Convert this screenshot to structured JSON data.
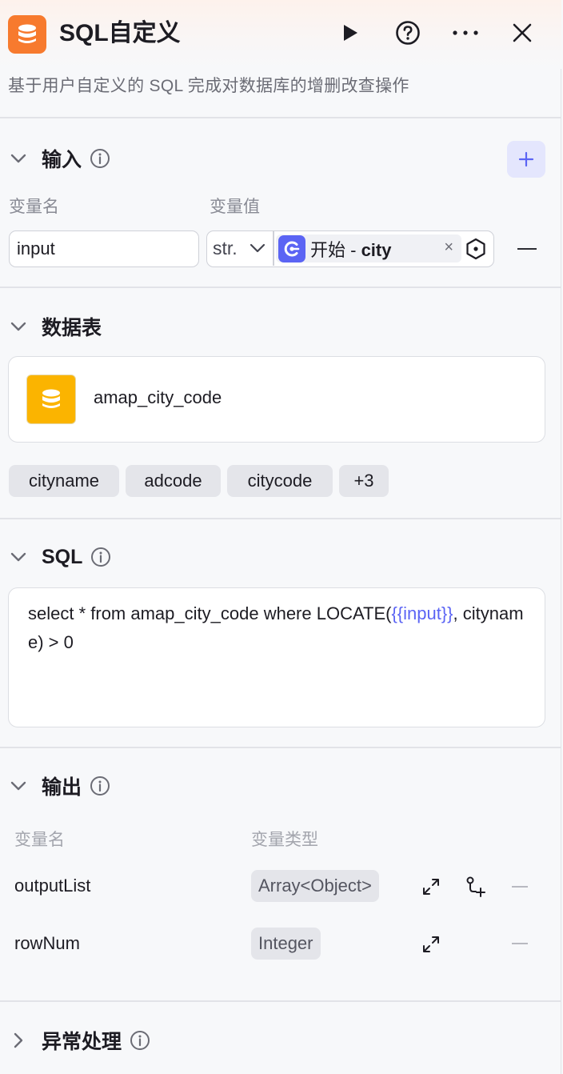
{
  "header": {
    "title": "SQL自定义",
    "description": "基于用户自定义的 SQL 完成对数据库的增删改查操作",
    "accent_color": "#f77a2e",
    "icons": [
      "database-icon",
      "run-icon",
      "help-icon",
      "more-icon",
      "close-icon"
    ]
  },
  "input_section": {
    "title": "输入",
    "col_name": "变量名",
    "col_value": "变量值",
    "rows": [
      {
        "name": "input",
        "type": "str.",
        "ref_label": "开始 - ",
        "ref_var": "city"
      }
    ]
  },
  "table_section": {
    "title": "数据表",
    "table_name": "amap_city_code",
    "fields": [
      "cityname",
      "adcode",
      "citycode",
      "+3"
    ]
  },
  "sql_section": {
    "title": "SQL",
    "query_before": "select * from amap_city_code where LOCATE(",
    "query_var": "{{input}}",
    "query_after": ", cityname) > 0"
  },
  "output_section": {
    "title": "输出",
    "col_name": "变量名",
    "col_type": "变量类型",
    "rows": [
      {
        "name": "outputList",
        "type": "Array<Object>"
      },
      {
        "name": "rowNum",
        "type": "Integer"
      }
    ]
  },
  "error_section": {
    "title": "异常处理"
  },
  "colors": {
    "primary": "#5b64f4",
    "table_icon": "#fbb400"
  }
}
